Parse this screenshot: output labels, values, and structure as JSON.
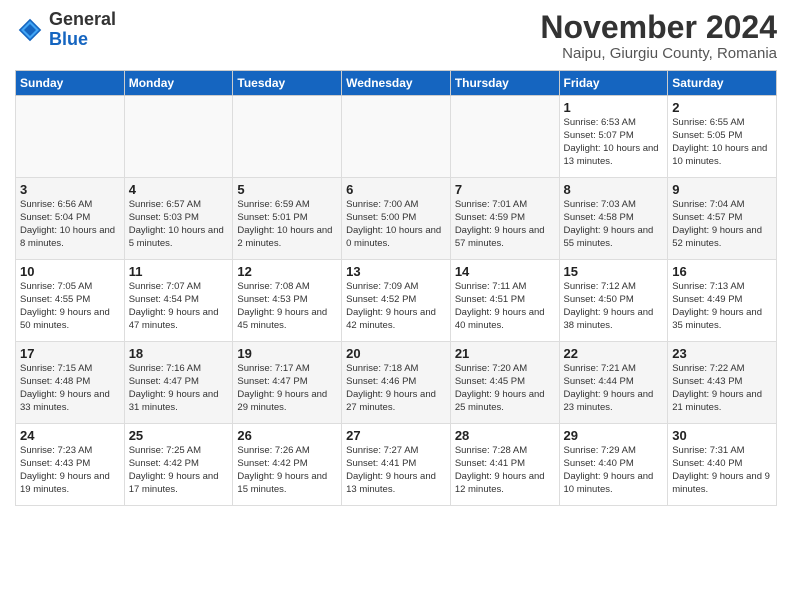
{
  "logo": {
    "general": "General",
    "blue": "Blue"
  },
  "header": {
    "month": "November 2024",
    "location": "Naipu, Giurgiu County, Romania"
  },
  "weekdays": [
    "Sunday",
    "Monday",
    "Tuesday",
    "Wednesday",
    "Thursday",
    "Friday",
    "Saturday"
  ],
  "weeks": [
    [
      {
        "day": "",
        "info": ""
      },
      {
        "day": "",
        "info": ""
      },
      {
        "day": "",
        "info": ""
      },
      {
        "day": "",
        "info": ""
      },
      {
        "day": "",
        "info": ""
      },
      {
        "day": "1",
        "info": "Sunrise: 6:53 AM\nSunset: 5:07 PM\nDaylight: 10 hours and 13 minutes."
      },
      {
        "day": "2",
        "info": "Sunrise: 6:55 AM\nSunset: 5:05 PM\nDaylight: 10 hours and 10 minutes."
      }
    ],
    [
      {
        "day": "3",
        "info": "Sunrise: 6:56 AM\nSunset: 5:04 PM\nDaylight: 10 hours and 8 minutes."
      },
      {
        "day": "4",
        "info": "Sunrise: 6:57 AM\nSunset: 5:03 PM\nDaylight: 10 hours and 5 minutes."
      },
      {
        "day": "5",
        "info": "Sunrise: 6:59 AM\nSunset: 5:01 PM\nDaylight: 10 hours and 2 minutes."
      },
      {
        "day": "6",
        "info": "Sunrise: 7:00 AM\nSunset: 5:00 PM\nDaylight: 10 hours and 0 minutes."
      },
      {
        "day": "7",
        "info": "Sunrise: 7:01 AM\nSunset: 4:59 PM\nDaylight: 9 hours and 57 minutes."
      },
      {
        "day": "8",
        "info": "Sunrise: 7:03 AM\nSunset: 4:58 PM\nDaylight: 9 hours and 55 minutes."
      },
      {
        "day": "9",
        "info": "Sunrise: 7:04 AM\nSunset: 4:57 PM\nDaylight: 9 hours and 52 minutes."
      }
    ],
    [
      {
        "day": "10",
        "info": "Sunrise: 7:05 AM\nSunset: 4:55 PM\nDaylight: 9 hours and 50 minutes."
      },
      {
        "day": "11",
        "info": "Sunrise: 7:07 AM\nSunset: 4:54 PM\nDaylight: 9 hours and 47 minutes."
      },
      {
        "day": "12",
        "info": "Sunrise: 7:08 AM\nSunset: 4:53 PM\nDaylight: 9 hours and 45 minutes."
      },
      {
        "day": "13",
        "info": "Sunrise: 7:09 AM\nSunset: 4:52 PM\nDaylight: 9 hours and 42 minutes."
      },
      {
        "day": "14",
        "info": "Sunrise: 7:11 AM\nSunset: 4:51 PM\nDaylight: 9 hours and 40 minutes."
      },
      {
        "day": "15",
        "info": "Sunrise: 7:12 AM\nSunset: 4:50 PM\nDaylight: 9 hours and 38 minutes."
      },
      {
        "day": "16",
        "info": "Sunrise: 7:13 AM\nSunset: 4:49 PM\nDaylight: 9 hours and 35 minutes."
      }
    ],
    [
      {
        "day": "17",
        "info": "Sunrise: 7:15 AM\nSunset: 4:48 PM\nDaylight: 9 hours and 33 minutes."
      },
      {
        "day": "18",
        "info": "Sunrise: 7:16 AM\nSunset: 4:47 PM\nDaylight: 9 hours and 31 minutes."
      },
      {
        "day": "19",
        "info": "Sunrise: 7:17 AM\nSunset: 4:47 PM\nDaylight: 9 hours and 29 minutes."
      },
      {
        "day": "20",
        "info": "Sunrise: 7:18 AM\nSunset: 4:46 PM\nDaylight: 9 hours and 27 minutes."
      },
      {
        "day": "21",
        "info": "Sunrise: 7:20 AM\nSunset: 4:45 PM\nDaylight: 9 hours and 25 minutes."
      },
      {
        "day": "22",
        "info": "Sunrise: 7:21 AM\nSunset: 4:44 PM\nDaylight: 9 hours and 23 minutes."
      },
      {
        "day": "23",
        "info": "Sunrise: 7:22 AM\nSunset: 4:43 PM\nDaylight: 9 hours and 21 minutes."
      }
    ],
    [
      {
        "day": "24",
        "info": "Sunrise: 7:23 AM\nSunset: 4:43 PM\nDaylight: 9 hours and 19 minutes."
      },
      {
        "day": "25",
        "info": "Sunrise: 7:25 AM\nSunset: 4:42 PM\nDaylight: 9 hours and 17 minutes."
      },
      {
        "day": "26",
        "info": "Sunrise: 7:26 AM\nSunset: 4:42 PM\nDaylight: 9 hours and 15 minutes."
      },
      {
        "day": "27",
        "info": "Sunrise: 7:27 AM\nSunset: 4:41 PM\nDaylight: 9 hours and 13 minutes."
      },
      {
        "day": "28",
        "info": "Sunrise: 7:28 AM\nSunset: 4:41 PM\nDaylight: 9 hours and 12 minutes."
      },
      {
        "day": "29",
        "info": "Sunrise: 7:29 AM\nSunset: 4:40 PM\nDaylight: 9 hours and 10 minutes."
      },
      {
        "day": "30",
        "info": "Sunrise: 7:31 AM\nSunset: 4:40 PM\nDaylight: 9 hours and 9 minutes."
      }
    ]
  ]
}
